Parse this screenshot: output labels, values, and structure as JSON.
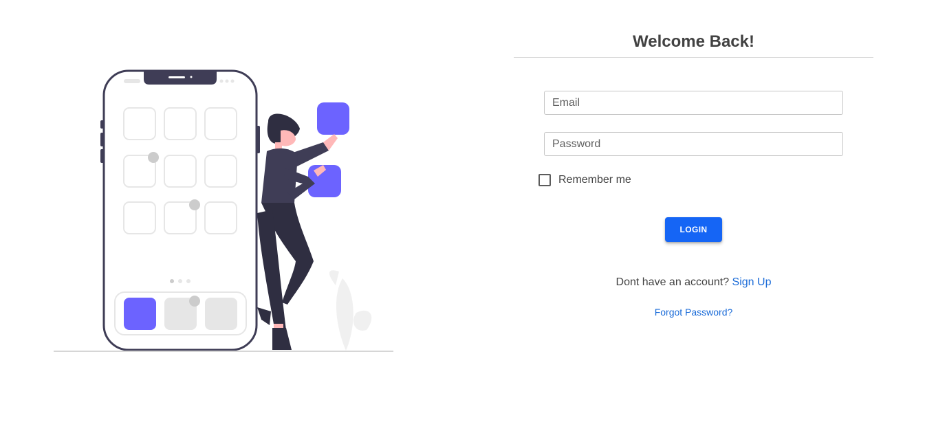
{
  "login": {
    "title": "Welcome Back!",
    "email_placeholder": "Email",
    "password_placeholder": "Password",
    "remember_label": "Remember me",
    "remember_checked": false,
    "login_button_label": "LOGIN",
    "no_account_text": "Dont have an account?",
    "signup_link_label": "Sign Up",
    "forgot_password_label": "Forgot Password?"
  },
  "colors": {
    "accent": "#1565f5",
    "link": "#1a6bd8",
    "illustration_purple": "#6c63ff",
    "illustration_dark": "#3f3d56"
  },
  "illustration": {
    "icon": "person-phone-app-illustration"
  }
}
